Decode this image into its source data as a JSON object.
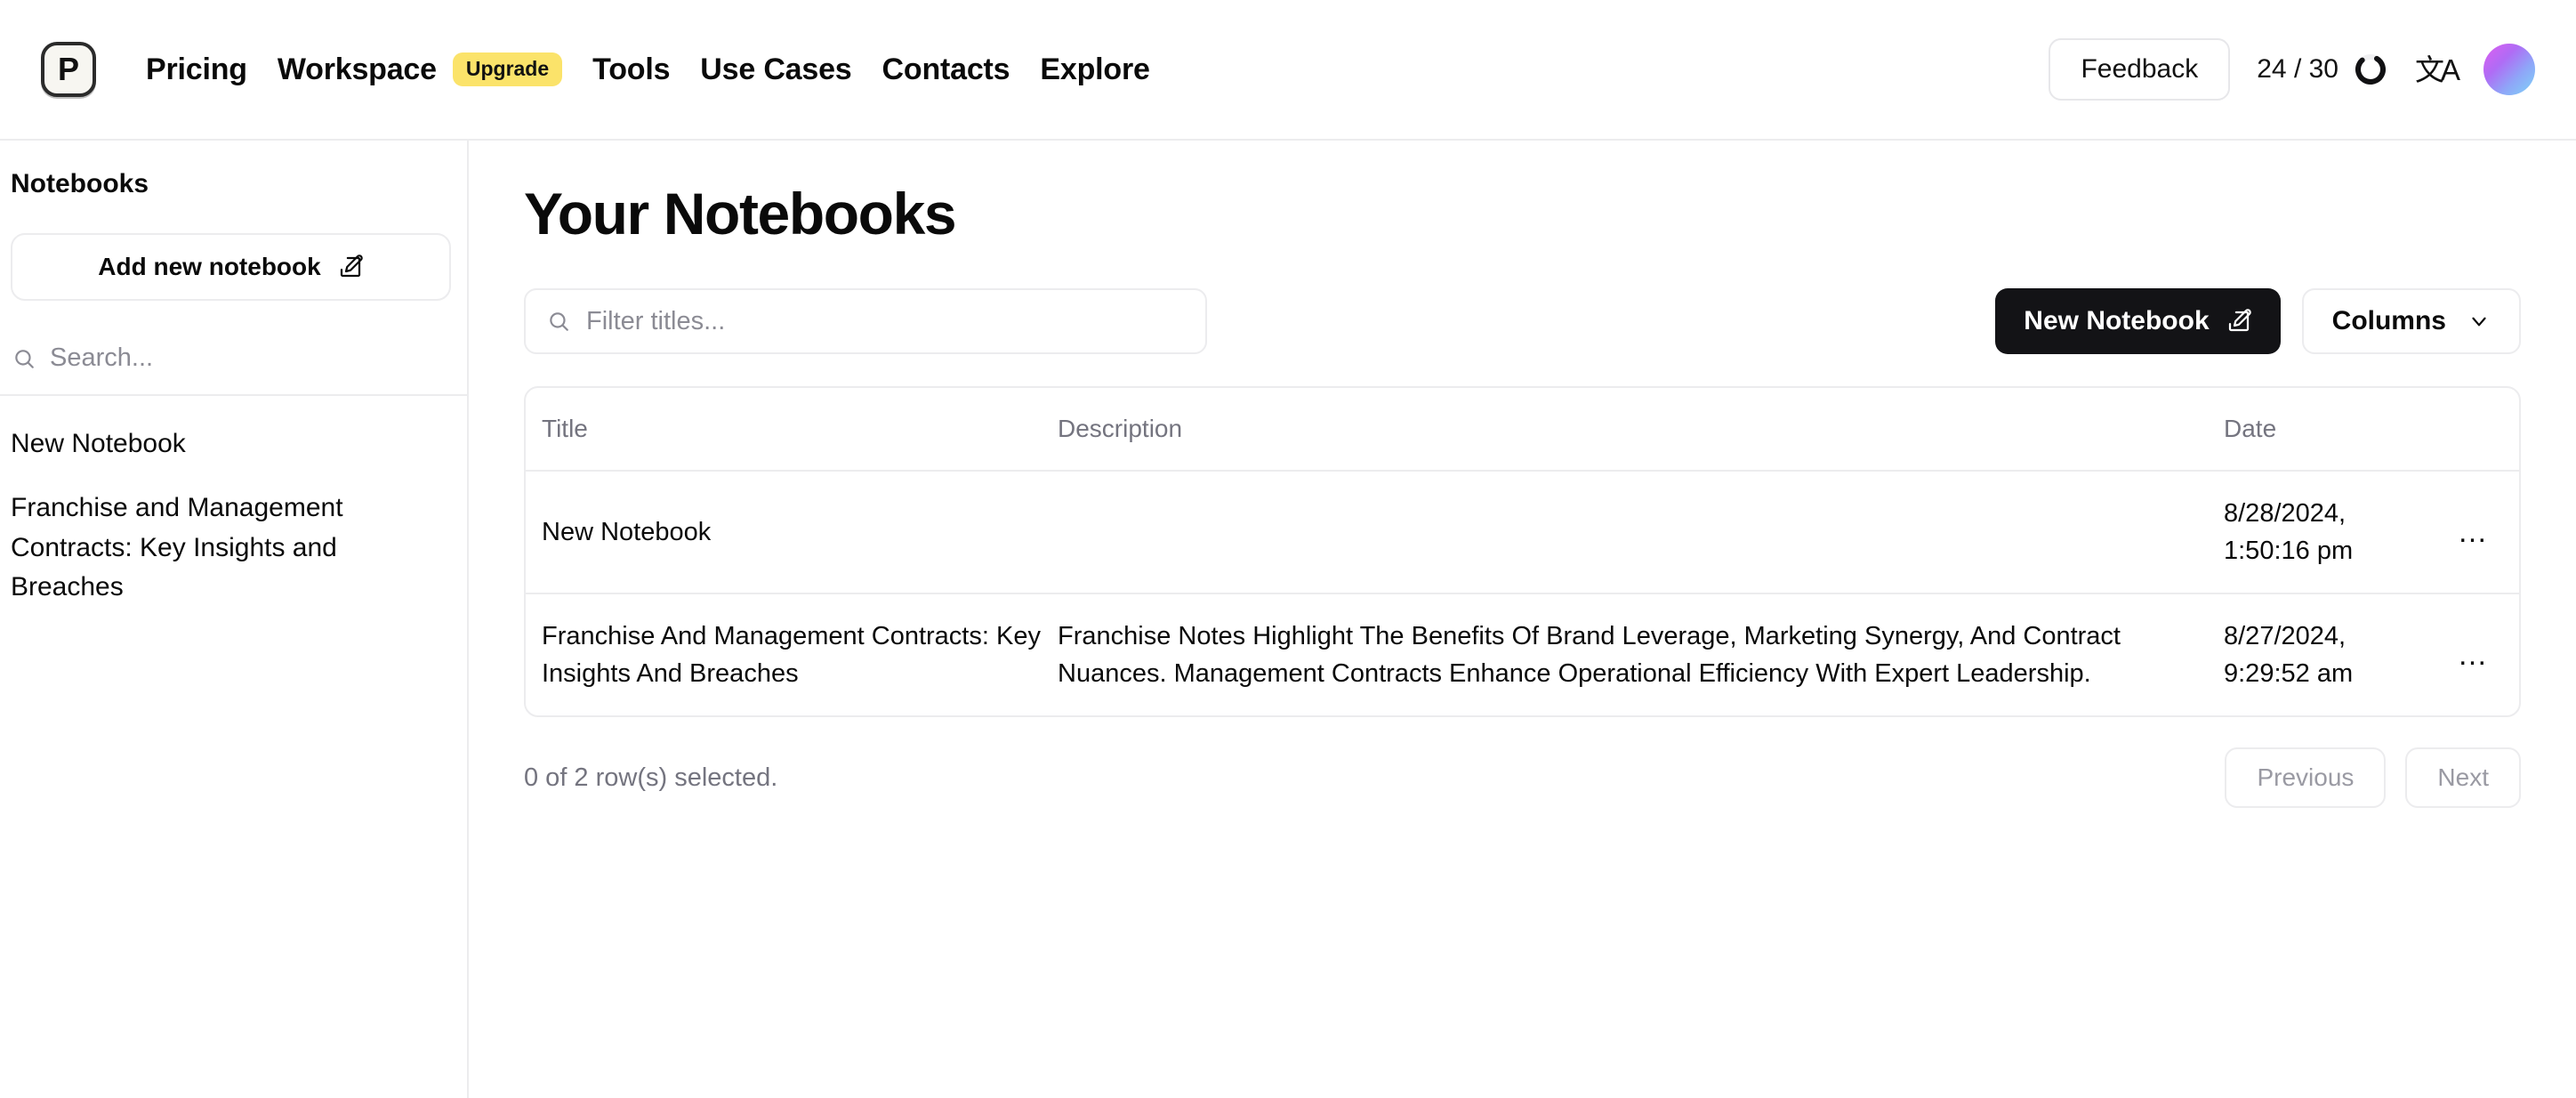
{
  "navbar": {
    "logo_letter": "P",
    "links": [
      {
        "label": "Pricing"
      },
      {
        "label": "Workspace"
      },
      {
        "label": "Tools"
      },
      {
        "label": "Use Cases"
      },
      {
        "label": "Contacts"
      },
      {
        "label": "Explore"
      }
    ],
    "upgrade_badge": "Upgrade",
    "feedback_label": "Feedback",
    "credits_text": "24 / 30",
    "credits_used": 24,
    "credits_total": 30,
    "translate_icon_glyph": "文A",
    "accent_yellow": "#fbe36a",
    "avatar_gradient_from": "#e05ef0",
    "avatar_gradient_to": "#7fd4f7"
  },
  "sidebar": {
    "title": "Notebooks",
    "add_button_label": "Add new notebook",
    "search_placeholder": "Search...",
    "notebooks": [
      {
        "label": "New Notebook"
      },
      {
        "label": "Franchise and Management Contracts: Key Insights and Breaches"
      }
    ]
  },
  "main": {
    "page_title": "Your Notebooks",
    "filter_placeholder": "Filter titles...",
    "new_notebook_label": "New Notebook",
    "columns_label": "Columns",
    "table": {
      "columns": [
        {
          "label": "Title"
        },
        {
          "label": "Description"
        },
        {
          "label": "Date"
        },
        {
          "label": ""
        }
      ],
      "rows": [
        {
          "title": "New Notebook",
          "description": "",
          "date": "8/28/2024, 1:50:16 pm",
          "actions": "…"
        },
        {
          "title": "Franchise And Management Contracts: Key Insights And Breaches",
          "description": "Franchise Notes Highlight The Benefits Of Brand Leverage, Marketing Synergy, And Contract Nuances. Management Contracts Enhance Operational Efficiency With Expert Leadership.",
          "date": "8/27/2024, 9:29:52 am",
          "actions": "…"
        }
      ]
    },
    "footer": {
      "rows_selected": "0 of 2 row(s) selected.",
      "previous_label": "Previous",
      "next_label": "Next"
    }
  }
}
